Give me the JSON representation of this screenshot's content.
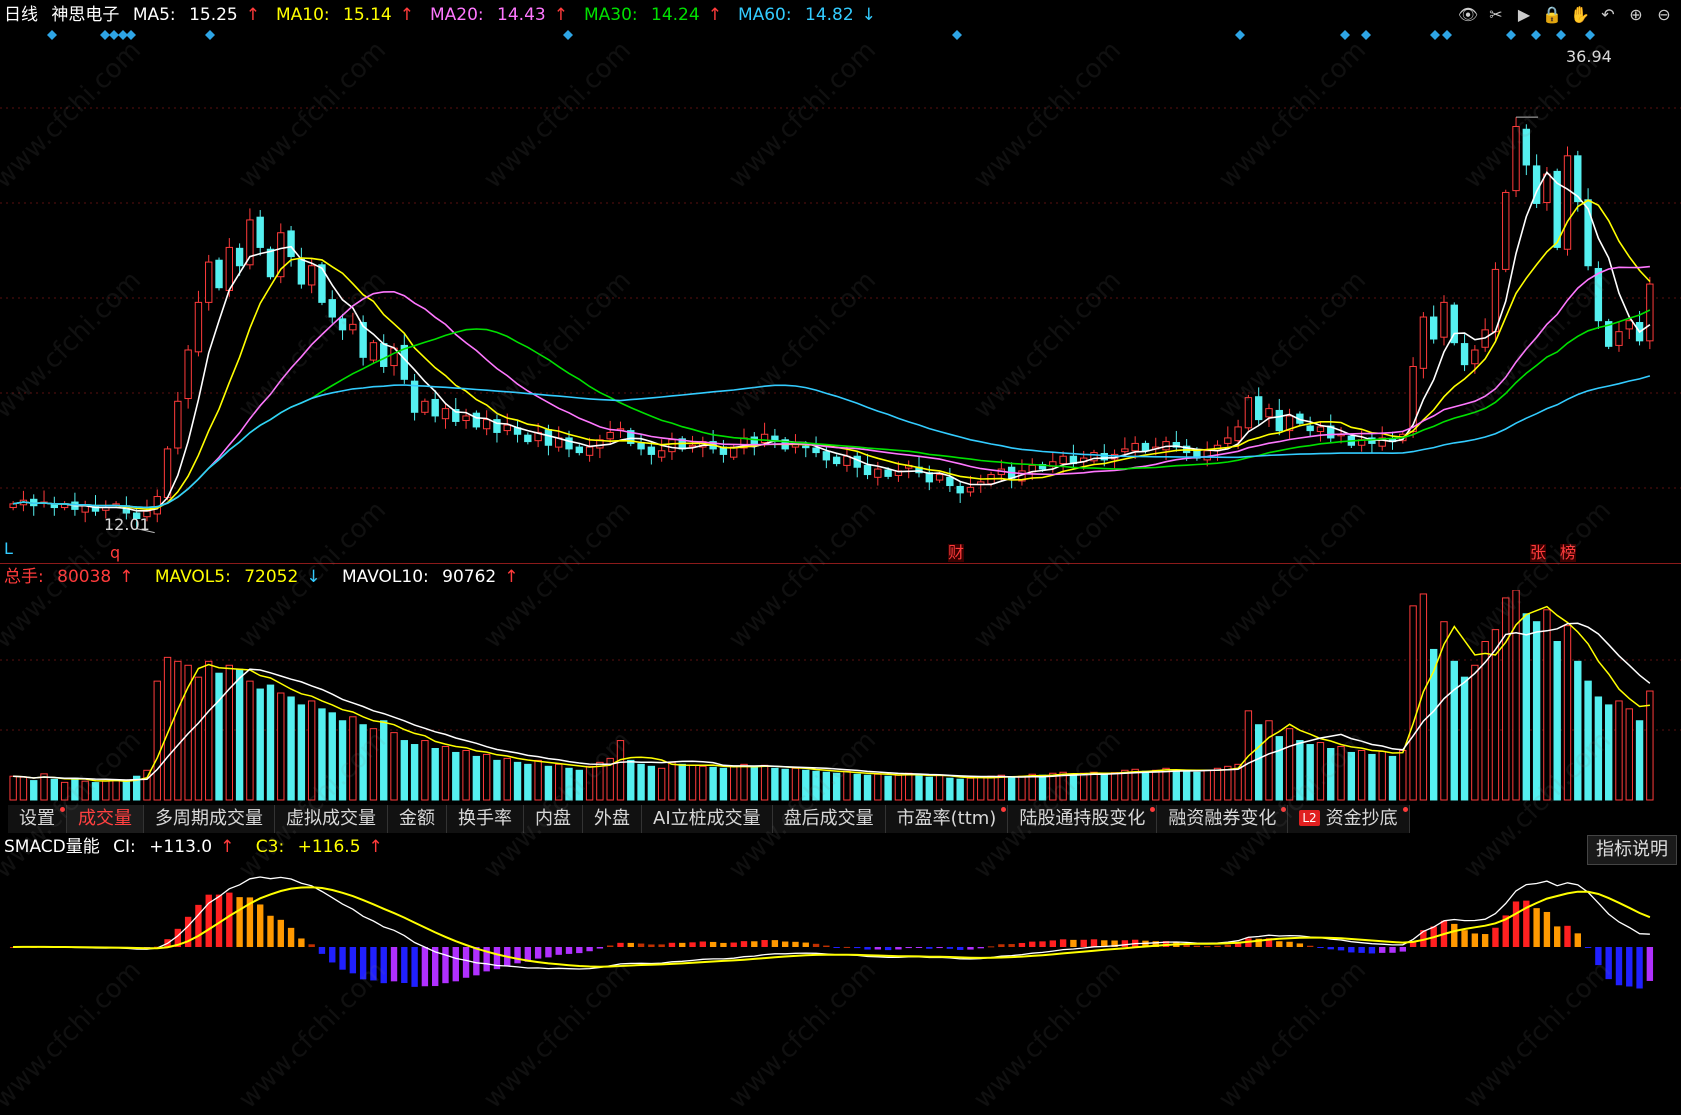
{
  "header": {
    "period": "日线",
    "stock_name": "神思电子",
    "ma": [
      {
        "label": "MA5:",
        "value": "15.25",
        "dir": "↑",
        "color": "#ffffff"
      },
      {
        "label": "MA10:",
        "value": "15.14",
        "dir": "↑",
        "color": "#ffff00"
      },
      {
        "label": "MA20:",
        "value": "14.43",
        "dir": "↑",
        "color": "#ff77ff"
      },
      {
        "label": "MA30:",
        "value": "14.24",
        "dir": "↑",
        "color": "#00e000"
      },
      {
        "label": "MA60:",
        "value": "14.82",
        "dir": "↓",
        "color": "#33ccff"
      }
    ]
  },
  "toolbar": {
    "icons": [
      "eye-icon",
      "scissors-icon",
      "play-icon",
      "lock-icon",
      "hand-icon",
      "undo-icon",
      "zoom-in-icon",
      "zoom-out-icon"
    ]
  },
  "price_chart": {
    "high_label": "36.94",
    "low_label": "12.01",
    "markers": {
      "L": "L",
      "q": "q",
      "cai": "财",
      "zhang": "张",
      "bang": "榜"
    }
  },
  "volume_header": {
    "total_label": "总手:",
    "total_value": "80038",
    "total_dir": "↑",
    "mavol5_label": "MAVOL5:",
    "mavol5_value": "72052",
    "mavol5_dir": "↓",
    "mavol10_label": "MAVOL10:",
    "mavol10_value": "90762",
    "mavol10_dir": "↑"
  },
  "tabs": [
    {
      "label": "设置",
      "dot": true,
      "active": false
    },
    {
      "label": "成交量",
      "dot": false,
      "active": true
    },
    {
      "label": "多周期成交量",
      "dot": false,
      "active": false
    },
    {
      "label": "虚拟成交量",
      "dot": false,
      "active": false
    },
    {
      "label": "金额",
      "dot": false,
      "active": false
    },
    {
      "label": "换手率",
      "dot": false,
      "active": false
    },
    {
      "label": "内盘",
      "dot": false,
      "active": false
    },
    {
      "label": "外盘",
      "dot": false,
      "active": false
    },
    {
      "label": "AI立桩成交量",
      "dot": false,
      "active": false
    },
    {
      "label": "盘后成交量",
      "dot": false,
      "active": false
    },
    {
      "label": "市盈率(ttm)",
      "dot": true,
      "active": false
    },
    {
      "label": "陆股通持股变化",
      "dot": true,
      "active": false
    },
    {
      "label": "融资融券变化",
      "dot": true,
      "active": false
    },
    {
      "label": "资金抄底",
      "dot": true,
      "active": false,
      "badge": "L2"
    }
  ],
  "macd_header": {
    "name": "SMACD量能",
    "ci_label": "CI:",
    "ci_value": "+113.0",
    "ci_dir": "↑",
    "c3_label": "C3:",
    "c3_value": "+116.5",
    "c3_dir": "↑"
  },
  "explain_button": "指标说明",
  "watermark": "www.cfchi.com",
  "colors": {
    "up": "#ff3b3b",
    "down": "#55f0f0",
    "ma5": "#ffffff",
    "ma10": "#ffff00",
    "ma20": "#ff77ff",
    "ma30": "#00e000",
    "ma60": "#33ccff"
  },
  "chart_data": {
    "type": "candlestick",
    "price_axis": {
      "min": 12.01,
      "max": 36.94
    },
    "close": [
      13.0,
      13.2,
      12.9,
      13.1,
      12.8,
      13.0,
      12.7,
      12.9,
      12.6,
      12.8,
      13.0,
      12.5,
      12.2,
      12.6,
      13.4,
      16.0,
      18.6,
      21.4,
      24.0,
      26.2,
      24.8,
      27.0,
      26.0,
      28.5,
      27.0,
      25.4,
      27.8,
      26.5,
      25.0,
      26.0,
      24.0,
      23.2,
      22.5,
      22.8,
      21.0,
      21.8,
      20.5,
      21.5,
      19.8,
      18.0,
      18.6,
      17.8,
      18.2,
      17.5,
      17.8,
      17.2,
      17.6,
      16.9,
      17.3,
      16.8,
      16.4,
      16.9,
      16.2,
      16.6,
      16.0,
      15.8,
      16.1,
      16.5,
      16.9,
      17.1,
      16.3,
      16.0,
      15.7,
      15.9,
      16.5,
      16.0,
      16.2,
      16.4,
      16.0,
      15.7,
      16.1,
      16.6,
      16.2,
      16.8,
      16.5,
      16.0,
      16.3,
      16.1,
      15.8,
      15.4,
      15.2,
      15.6,
      15.0,
      14.6,
      14.9,
      14.5,
      14.8,
      15.1,
      14.7,
      14.2,
      14.6,
      14.0,
      13.6,
      13.9,
      14.2,
      14.6,
      14.9,
      14.4,
      14.8,
      15.1,
      14.9,
      15.3,
      15.6,
      15.2,
      15.5,
      15.8,
      15.4,
      15.7,
      16.0,
      16.3,
      15.9,
      16.1,
      16.4,
      16.1,
      15.8,
      15.5,
      15.9,
      16.2,
      16.6,
      17.2,
      18.8,
      17.6,
      18.2,
      17.0,
      17.8,
      17.4,
      17.0,
      17.2,
      16.6,
      16.8,
      16.2,
      16.5,
      16.3,
      16.6,
      16.4,
      16.8,
      20.5,
      23.2,
      22.0,
      24.0,
      21.8,
      20.6,
      21.4,
      22.5,
      25.8,
      30.0,
      33.6,
      31.5,
      29.4,
      31.0,
      27.0,
      32.0,
      29.5,
      26.0,
      23.0,
      21.6,
      22.4,
      23.0,
      21.9,
      25.0
    ],
    "volume": [
      12000,
      11500,
      9800,
      13200,
      10400,
      8900,
      11000,
      9500,
      8800,
      9700,
      10200,
      9300,
      12000,
      15000,
      60000,
      72000,
      70000,
      68000,
      62000,
      70000,
      64000,
      68000,
      66000,
      60000,
      56000,
      58000,
      54000,
      52000,
      48000,
      50000,
      46000,
      44000,
      40000,
      42000,
      38000,
      36000,
      40000,
      34000,
      30000,
      28000,
      30000,
      26000,
      27000,
      24000,
      25000,
      22000,
      23000,
      20000,
      21000,
      19000,
      18000,
      20000,
      17000,
      18000,
      16000,
      15000,
      17000,
      19000,
      21000,
      30000,
      20000,
      18000,
      17000,
      16000,
      19000,
      18000,
      17500,
      17000,
      16500,
      16000,
      17000,
      18000,
      16500,
      17500,
      16000,
      15500,
      16000,
      15000,
      14500,
      14000,
      13500,
      14500,
      13000,
      12500,
      13000,
      12000,
      12500,
      13500,
      12500,
      11500,
      12500,
      11000,
      10500,
      11000,
      11500,
      12000,
      12500,
      11500,
      12000,
      13000,
      12500,
      13500,
      14000,
      13000,
      13500,
      14000,
      13200,
      13800,
      15000,
      15500,
      14500,
      15000,
      16000,
      15200,
      14800,
      14000,
      15000,
      16000,
      17000,
      18000,
      45000,
      38000,
      40000,
      32000,
      36000,
      30000,
      28000,
      29000,
      26000,
      27000,
      24000,
      25000,
      23000,
      24500,
      22000,
      25000,
      98000,
      104000,
      76000,
      90000,
      70000,
      62000,
      68000,
      80000,
      86000,
      102000,
      106000,
      94000,
      90000,
      96000,
      80000,
      88000,
      70000,
      60000,
      52000,
      48000,
      50000,
      46000,
      40000,
      55000
    ]
  }
}
